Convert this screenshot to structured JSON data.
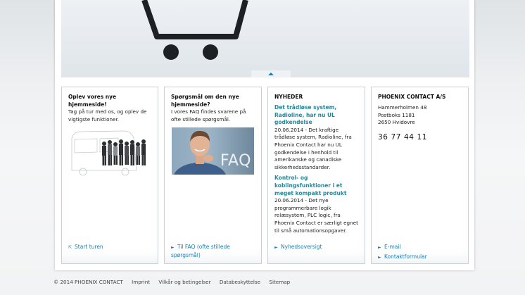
{
  "boxes": {
    "tour": {
      "title": "Oplev vores nye hjemmeside!",
      "text": "Tag på tur med os, og oplev de vigtigste funktioner.",
      "link": "Start turen"
    },
    "faq": {
      "title": "Spørgsmål om den nye hjemmeside?",
      "text": "I vores FAQ findes svarene på ofte stillede spørgsmål.",
      "image_text": "FAQ",
      "link": "Til FAQ (ofte stillede spørgsmål)"
    },
    "news": {
      "heading": "NYHEDER",
      "items": [
        {
          "title": "Det trådløse system, Radioline, har nu UL godkendelse",
          "text": "20.06.2014 - Det kraftige trådløse system, Radioline, fra Phoenix Contact har nu UL godkendelse i henhold til amerikanske og canadiske sikkerhedsstandarder."
        },
        {
          "title": "Kontrol- og koblingsfunktioner i et meget kompakt produkt",
          "text": "20.06.2014 - Det nye programmerbare logik relæsystem, PLC logic, fra Phoenix Contact er særligt egnet til små automationsopgaver."
        }
      ],
      "link": "Nyhedsoversigt"
    },
    "contact": {
      "heading": "PHOENIX CONTACT A/S",
      "address": [
        "Hammerholmen 48",
        "Postboks 1181",
        "2650 Hvidovre"
      ],
      "phone": "36 77 44 11",
      "links": [
        "E-mail",
        "Kontaktformular"
      ]
    }
  },
  "footer": {
    "copyright": "© 2014 PHOENIX CONTACT",
    "links": [
      "Imprint",
      "Vilkår og betingelser",
      "Databeskyttelse",
      "Sitemap"
    ]
  },
  "colors": {
    "link": "#1a7fb5",
    "news_title": "#1f8a9e",
    "border": "#c9d1d7"
  },
  "icons": [
    "shopping-cart-icon",
    "up-arrow-icon",
    "external-link-icon",
    "arrow-right-icon"
  ]
}
